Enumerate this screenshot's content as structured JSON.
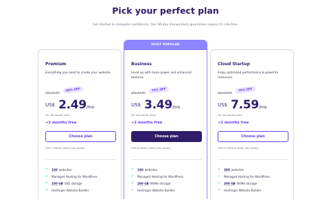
{
  "header": {
    "title": "Pick your perfect plan",
    "subtitle": "Get started in complete confidence. Our 30-day money-back guarantee means it's risk-free."
  },
  "plans": [
    {
      "name": "Premium",
      "description": "Everything you need to create your website.",
      "old_price": "US$ 11.99",
      "discount": "80% OFF",
      "currency": "US$",
      "price": "2.49",
      "period": "/mo",
      "term_note": "For 48-month term",
      "bonus": "+2 months free",
      "button_label": "Choose plan",
      "renew_note": "US$ 7.99/mo when you renew",
      "features": [
        {
          "strong": "100",
          "text": "websites"
        },
        {
          "strong": "",
          "text": "Managed Hosting for WordPress"
        },
        {
          "strong": "100 GB",
          "text": "SSD storage"
        },
        {
          "strong": "",
          "text": "Hostinger Website Builder"
        }
      ]
    },
    {
      "name": "Business",
      "badge": "MOST POPULAR",
      "description": "Level up with more power and enhanced features.",
      "old_price": "US$ 13.99",
      "discount": "75% OFF",
      "currency": "US$",
      "price": "3.49",
      "period": "/mo",
      "term_note": "For 48-month term",
      "bonus": "+2 months free",
      "button_label": "Choose plan",
      "renew_note": "US$ 8.99/mo when you renew",
      "features": [
        {
          "strong": "100",
          "text": "websites"
        },
        {
          "strong": "",
          "text": "Managed Hosting for WordPress"
        },
        {
          "strong": "200 GB",
          "text": "NVMe storage"
        },
        {
          "strong": "",
          "text": "Hostinger Website Builder"
        }
      ]
    },
    {
      "name": "Cloud Startup",
      "description": "Enjoy optimized performance & powerful resources.",
      "old_price": "US$ 24.99",
      "discount": "70% OFF",
      "currency": "US$",
      "price": "7.59",
      "period": "/mo",
      "term_note": "For 48-month term",
      "bonus": "+2 months free",
      "button_label": "Choose plan",
      "renew_note": "US$ 19.99/mo when you renew",
      "features": [
        {
          "strong": "300",
          "text": "websites"
        },
        {
          "strong": "",
          "text": "Managed Hosting for WordPress"
        },
        {
          "strong": "200 GB",
          "text": "NVMe storage"
        },
        {
          "strong": "",
          "text": "Hostinger Website Builder"
        }
      ]
    }
  ],
  "colors": {
    "brand_dark": "#2f1c6a",
    "brand_purple": "#673de6",
    "popular_bar": "#8c85ff",
    "check": "#00b090"
  },
  "icons": {
    "check": "check-icon"
  }
}
